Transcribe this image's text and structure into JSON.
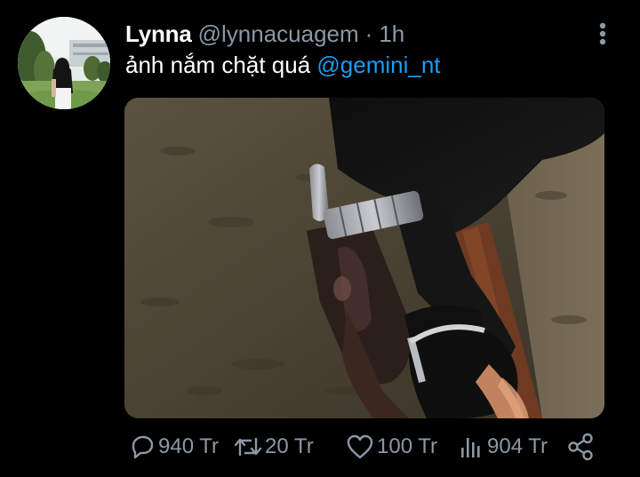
{
  "author": {
    "display_name": "Lynna",
    "handle": "@lynnacuagem",
    "separator": "·",
    "time": "1h"
  },
  "tweet": {
    "text": "ảnh nắm chặt quá ",
    "mention": "@gemini_nt"
  },
  "actions": {
    "replies": "940 Tr",
    "retweets": "20 Tr",
    "likes": "100 Tr",
    "views": "904 Tr"
  },
  "colors": {
    "background": "#000000",
    "secondary_text": "#8b98a5",
    "mention": "#1d9bf0"
  },
  "icons": {
    "more": "more-vertical-icon",
    "reply": "reply-icon",
    "retweet": "retweet-icon",
    "like": "heart-icon",
    "views": "analytics-icon",
    "share": "share-icon"
  }
}
